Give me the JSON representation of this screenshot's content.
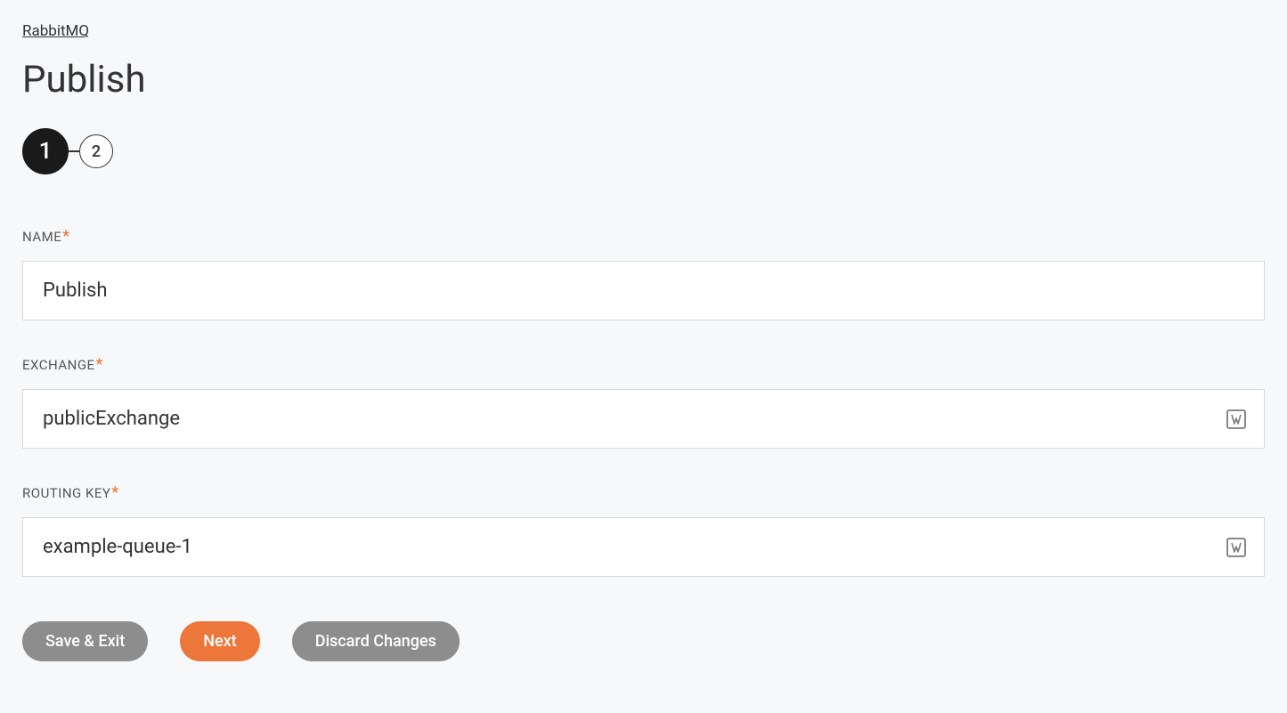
{
  "breadcrumb": "RabbitMQ",
  "title": "Publish",
  "stepper": {
    "steps": [
      "1",
      "2"
    ],
    "active_index": 0
  },
  "form": {
    "name": {
      "label": "NAME",
      "required": "*",
      "value": "Publish"
    },
    "exchange": {
      "label": "EXCHANGE",
      "required": "*",
      "value": "publicExchange"
    },
    "routing_key": {
      "label": "ROUTING KEY",
      "required": "*",
      "value": "example-queue-1"
    }
  },
  "buttons": {
    "save_exit": "Save & Exit",
    "next": "Next",
    "discard": "Discard Changes"
  }
}
